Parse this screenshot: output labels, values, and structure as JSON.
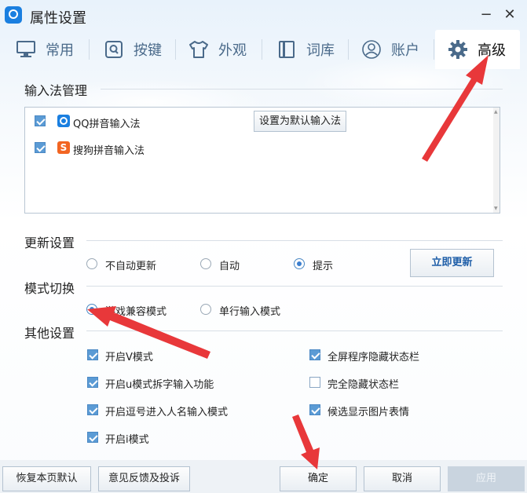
{
  "window": {
    "title": "属性设置",
    "minimize": "−",
    "close": "✕"
  },
  "tabs": [
    {
      "label": "常用",
      "icon": "monitor-icon"
    },
    {
      "label": "按键",
      "icon": "key-icon"
    },
    {
      "label": "外观",
      "icon": "shirt-icon"
    },
    {
      "label": "词库",
      "icon": "book-icon"
    },
    {
      "label": "账户",
      "icon": "user-icon"
    },
    {
      "label": "高级",
      "icon": "gear-icon",
      "active": true
    }
  ],
  "ime": {
    "title": "输入法管理",
    "items": [
      {
        "label": "QQ拼音输入法",
        "checked": true
      },
      {
        "label": "搜狗拼音输入法",
        "checked": true
      }
    ],
    "set_default_label": "设置为默认输入法"
  },
  "update": {
    "title": "更新设置",
    "options": [
      "不自动更新",
      "自动",
      "提示"
    ],
    "selected": "提示",
    "update_now_label": "立即更新"
  },
  "mode": {
    "title": "模式切换",
    "options": [
      "游戏兼容模式",
      "单行输入模式"
    ],
    "selected": "游戏兼容模式"
  },
  "other": {
    "title": "其他设置",
    "left": [
      {
        "label": "开启V模式",
        "checked": true
      },
      {
        "label": "开启u模式拆字输入功能",
        "checked": true
      },
      {
        "label": "开启逗号进入人名输入模式",
        "checked": true
      },
      {
        "label": "开启i模式",
        "checked": true
      }
    ],
    "right": [
      {
        "label": "全屏程序隐藏状态栏",
        "checked": true
      },
      {
        "label": "完全隐藏状态栏",
        "checked": false
      },
      {
        "label": "候选显示图片表情",
        "checked": true
      }
    ]
  },
  "footer": {
    "restore_label": "恢复本页默认",
    "feedback_label": "意见反馈及投诉",
    "ok_label": "确定",
    "cancel_label": "取消",
    "apply_label": "应用"
  },
  "colors": {
    "accent": "#1a7fe0",
    "arrow": "#e8383a",
    "check": "#5b9bd5"
  }
}
